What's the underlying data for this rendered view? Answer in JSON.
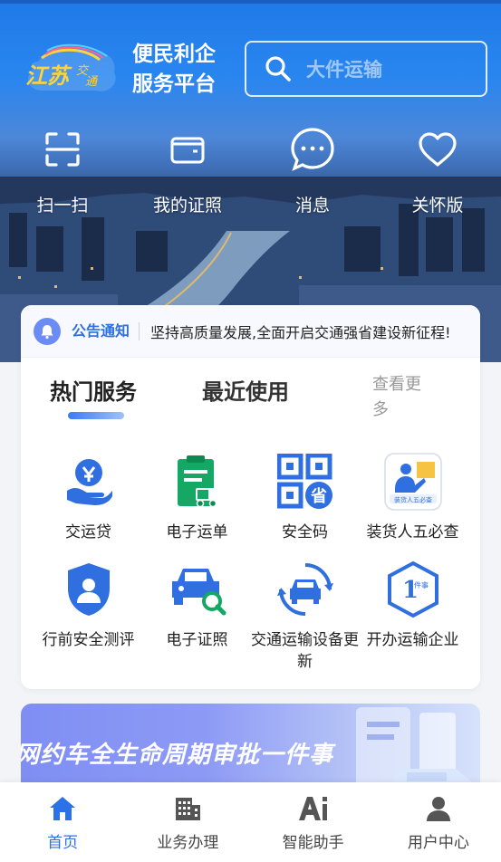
{
  "header": {
    "logo_text": "江苏交通",
    "brand_line1": "便民利企",
    "brand_line2": "服务平台",
    "search": {
      "placeholder": "大件运输"
    }
  },
  "quick_actions": [
    {
      "label": "扫一扫",
      "icon": "scan-icon"
    },
    {
      "label": "我的证照",
      "icon": "wallet-icon"
    },
    {
      "label": "消息",
      "icon": "message-icon"
    },
    {
      "label": "关怀版",
      "icon": "heart-icon"
    }
  ],
  "notice": {
    "tag": "公告通知",
    "text": "坚持高质量发展,全面开启交通强省建设新征程!"
  },
  "tabs": {
    "active": "热门服务",
    "inactive": "最近使用",
    "more": "查看更多"
  },
  "services": [
    {
      "label": "交运贷",
      "icon": "loan-hand-icon"
    },
    {
      "label": "电子运单",
      "icon": "waybill-truck-icon"
    },
    {
      "label": "安全码",
      "icon": "qr-code-icon",
      "badge": "省"
    },
    {
      "label": "装货人五必查",
      "icon": "loader-check-icon",
      "badge": "装货人五必查"
    },
    {
      "label": "行前安全测评",
      "icon": "shield-driver-icon"
    },
    {
      "label": "电子证照",
      "icon": "car-search-icon"
    },
    {
      "label": "交通运输设备更新",
      "icon": "car-refresh-icon"
    },
    {
      "label": "开办运输企业",
      "icon": "one-thing-hex-icon",
      "badge": "1件事"
    }
  ],
  "banner": {
    "title": "网约车全生命周期审批一件事"
  },
  "bottom_nav": [
    {
      "label": "首页",
      "icon": "home-icon",
      "active": true
    },
    {
      "label": "业务办理",
      "icon": "building-icon",
      "active": false
    },
    {
      "label": "智能助手",
      "icon": "ai-icon",
      "active": false
    },
    {
      "label": "用户中心",
      "icon": "user-icon",
      "active": false
    }
  ],
  "colors": {
    "primary": "#2b72e8",
    "hero_blue": "#1f7ae8",
    "service_blue": "#2f6fe0",
    "service_green": "#14a864"
  }
}
